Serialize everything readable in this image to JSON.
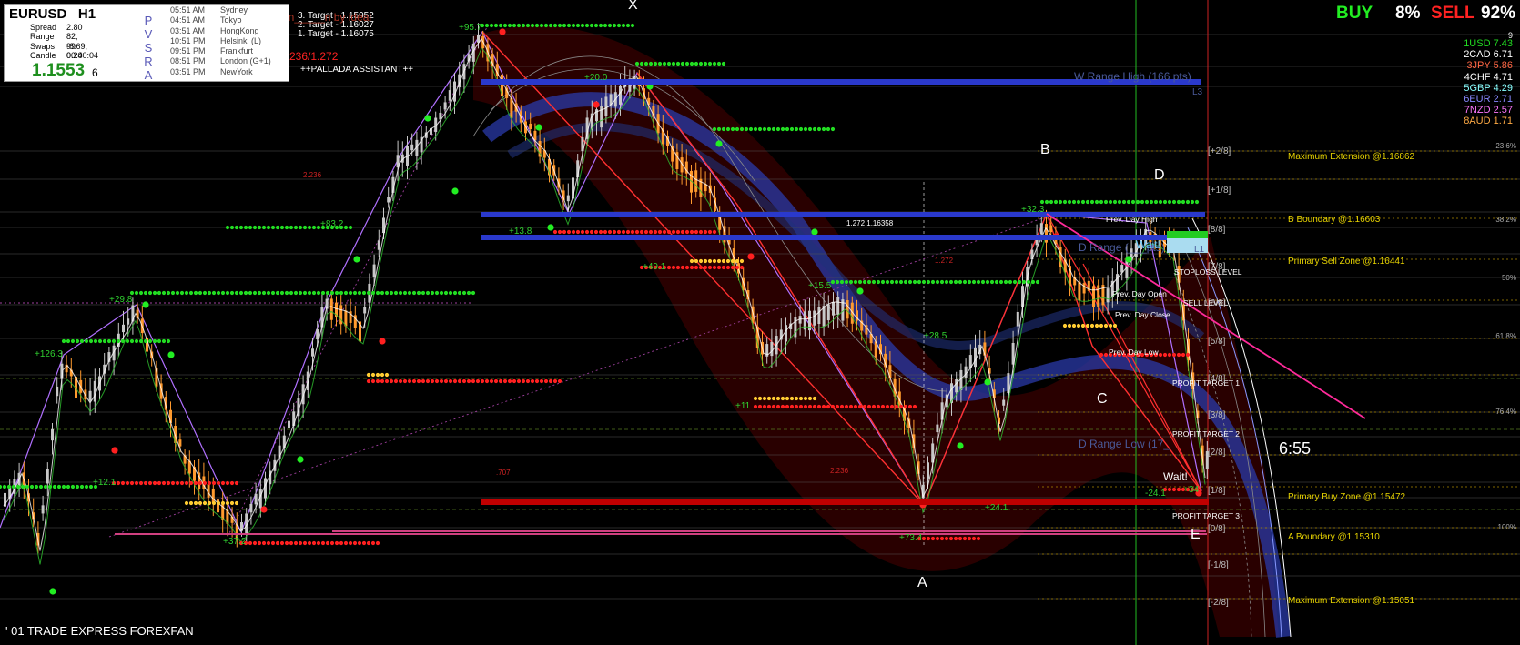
{
  "symbol": "EURUSD",
  "timeframe": "H1",
  "info": {
    "rows": [
      {
        "label": "Spread",
        "value": "2.80"
      },
      {
        "label": "Range",
        "value": "82, 99"
      },
      {
        "label": "Swaps",
        "value": "-6.69, 0.24"
      },
      {
        "label": "Candle",
        "value": "00:00:04"
      }
    ],
    "price": "1.1553",
    "price_digit": "6"
  },
  "pvsra": [
    "P",
    "V",
    "S",
    "R",
    "A"
  ],
  "sessions": [
    {
      "time": "05:51 AM",
      "city": "Sydney"
    },
    {
      "time": "04:51 AM",
      "city": "Tokyo"
    },
    {
      "time": "03:51 AM",
      "city": "HongKong"
    },
    {
      "time": "10:51 PM",
      "city": "Helsinki  (L)"
    },
    {
      "time": "09:51 PM",
      "city": "Frankfurt"
    },
    {
      "time": "08:51 PM",
      "city": "London  (G+1)"
    },
    {
      "time": "03:51 PM",
      "city": "NewYork"
    }
  ],
  "targets": [
    "3. Target - 1.15952",
    "2. Target - 1.16027",
    "1. Target - 1.16075"
  ],
  "overlay_texts": {
    "by_ideal": "en_____n by ideal",
    "ratio_a": "236/1.272",
    "assistant": "++PALLADA ASSISTANT++",
    "stoploss": "STOPLOSS LEVEL",
    "sell_level": "SELL LEVEL",
    "pt1": "PROFIT TARGET 1",
    "pt2": "PROFIT TARGET 2",
    "pt3": "PROFIT TARGET 3",
    "prev_day_high": "Prev. Day High",
    "prev_day_low": "Prev. Day Low",
    "prev_day_open": "Prev. Day Open",
    "prev_day_close": "Prev. Day Close",
    "w_range_high": "W Range High (166 pts)",
    "d_range_low": "D Range Low (17_",
    "d_range_high": "D Range (___pts)",
    "l3": "L3",
    "l1": "L1",
    "wait_top": "Wait!",
    "wait_bottom": "Wait!",
    "pct_label": "2.236",
    "pct_label2": "1.272",
    "pct_label3": ".707",
    "pct_label4": "2.236",
    "mid_label": "1.272  1.16358"
  },
  "wave_labels": [
    "X",
    "A",
    "B",
    "C",
    "D",
    "E"
  ],
  "murrey": [
    "[+2/8]",
    "[+1/8]",
    "[8/8]",
    "[7/8]",
    "[6/8]",
    "[5/8]",
    "[4/8]",
    "[3/8]",
    "[2/8]",
    "[1/8]",
    "[0/8]",
    "[-1/8]",
    "[-2/8]"
  ],
  "fib_levels": [
    "23.6%",
    "38.2%",
    "50%",
    "61.8%",
    "76.4%",
    "100%"
  ],
  "zones": [
    "Maximum Extension @1.16862",
    "B Boundary @1.16603",
    "Primary Sell Zone @1.16441",
    "Primary Buy Zone @1.15472",
    "A Boundary @1.15310",
    "Maximum Extension @1.15051"
  ],
  "swing_labels": [
    "+95.7",
    "+20.0",
    "+83.2",
    "+29.8",
    "+126.3",
    "+12.1",
    "+37.2",
    "+13.8",
    "+49.1",
    "+15.5",
    "+11",
    "+28.5",
    "+73.4",
    "+32.3",
    "+24.1",
    "-24.1",
    "+34"
  ],
  "header": {
    "buy": "BUY",
    "buy_pct": "8%",
    "sell": "SELL",
    "sell_pct": "92%"
  },
  "currency_strength": [
    {
      "rank": "1",
      "cur": "USD",
      "val": "7.43",
      "color": "#22dd22"
    },
    {
      "rank": "2",
      "cur": "CAD",
      "val": "6.71",
      "color": "#ffffff"
    },
    {
      "rank": "3",
      "cur": "JPY",
      "val": "5.86",
      "color": "#ff6644"
    },
    {
      "rank": "4",
      "cur": "CHF",
      "val": "4.71",
      "color": "#ffffff"
    },
    {
      "rank": "5",
      "cur": "GBP",
      "val": "4.29",
      "color": "#88ffff"
    },
    {
      "rank": "6",
      "cur": "EUR",
      "val": "2.71",
      "color": "#8888ff"
    },
    {
      "rank": "7",
      "cur": "NZD",
      "val": "2.57",
      "color": "#ff77ff"
    },
    {
      "rank": "8",
      "cur": "AUD",
      "val": "1.71",
      "color": "#ffaa44"
    }
  ],
  "currency_top_value": "9",
  "timer": "6:55",
  "footer": "' 01 TRADE EXPRESS FOREXFAN",
  "colors": {
    "bull": "#c8c8c8",
    "bear": "#ff9a2e",
    "support": "#ff2020",
    "resistance": "#22dd22",
    "channel": "#3344cc",
    "band": "#6a0000"
  }
}
